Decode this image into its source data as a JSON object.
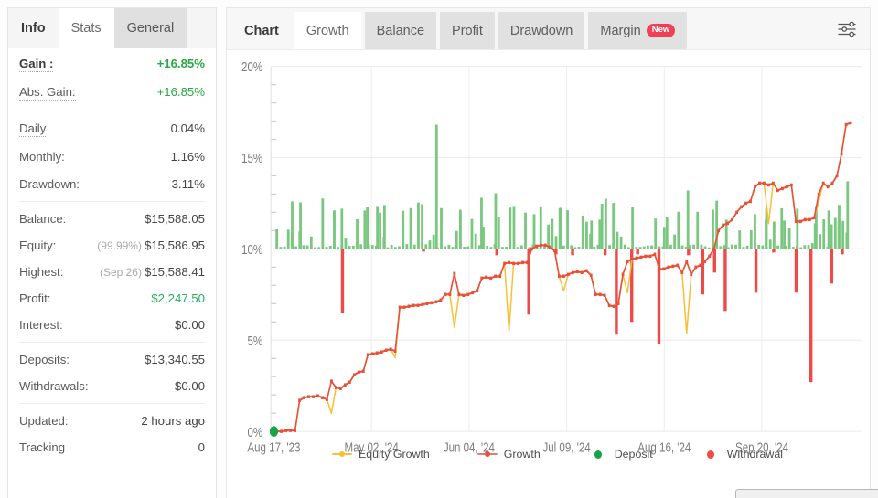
{
  "sidebar": {
    "tabs": [
      {
        "label": "Info",
        "state": "first"
      },
      {
        "label": "Stats",
        "state": "active"
      },
      {
        "label": "General",
        "state": "shaded"
      }
    ],
    "groups": [
      {
        "rows": [
          {
            "label": "Gain :",
            "value": "+16.85%",
            "style": "strong-green",
            "dotted": true
          },
          {
            "label": "Abs. Gain:",
            "value": "+16.85%",
            "style": "green",
            "dotted": true
          }
        ]
      },
      {
        "rows": [
          {
            "label": "Daily",
            "value": "0.04%",
            "style": "plain",
            "dotted": true
          },
          {
            "label": "Monthly:",
            "value": "1.16%",
            "style": "plain",
            "dotted": true
          },
          {
            "label": "Drawdown:",
            "value": "3.11%",
            "style": "plain",
            "dotted": false
          }
        ]
      },
      {
        "rows": [
          {
            "label": "Balance:",
            "value": "$15,588.05",
            "style": "plain",
            "dotted": false
          },
          {
            "label": "Equity:",
            "value": "$15,586.95",
            "sub": "(99.99%)",
            "style": "plain",
            "dotted": false
          },
          {
            "label": "Highest:",
            "value": "$15,588.41",
            "sub": "(Sep 26)",
            "style": "plain",
            "dotted": false
          },
          {
            "label": "Profit:",
            "value": "$2,247.50",
            "style": "green-b",
            "dotted": false
          },
          {
            "label": "Interest:",
            "value": "$0.00",
            "style": "plain",
            "dotted": false
          }
        ]
      },
      {
        "rows": [
          {
            "label": "Deposits:",
            "value": "$13,340.55",
            "style": "plain",
            "dotted": false
          },
          {
            "label": "Withdrawals:",
            "value": "$0.00",
            "style": "plain",
            "dotted": false
          }
        ]
      },
      {
        "rows": [
          {
            "label": "Updated:",
            "value": "2 hours ago",
            "style": "plain",
            "dotted": false
          },
          {
            "label": "Tracking",
            "value": "0",
            "style": "plain",
            "dotted": false
          }
        ]
      }
    ]
  },
  "chart_panel": {
    "tabs": [
      {
        "label": "Chart",
        "state": "first",
        "badge": ""
      },
      {
        "label": "Growth",
        "state": "active",
        "badge": ""
      },
      {
        "label": "Balance",
        "state": "normal",
        "badge": ""
      },
      {
        "label": "Profit",
        "state": "normal",
        "badge": ""
      },
      {
        "label": "Drawdown",
        "state": "normal",
        "badge": ""
      },
      {
        "label": "Margin",
        "state": "normal",
        "badge": "New"
      }
    ],
    "settings_icon": "sliders-icon"
  },
  "colors": {
    "growth": "#e8503a",
    "equity": "#f7c137",
    "deposit": "#16a34a",
    "deposit_bar": "#7ac77f",
    "withdrawal": "#ef4a4a",
    "grid": "#eeeeee",
    "axis_text": "#808080",
    "green_text": "#28a745",
    "badge_red": "#ef4056"
  },
  "chart_data": {
    "type": "line",
    "title": "Growth",
    "xlabel": "",
    "ylabel": "",
    "ylim": [
      0,
      20
    ],
    "yticks": [
      0,
      5,
      10,
      15,
      20
    ],
    "ytick_labels": [
      "0%",
      "5%",
      "10%",
      "15%",
      "20%"
    ],
    "grid": true,
    "legend_position": "bottom",
    "xtick_labels": [
      "Aug 17, '23",
      "May 02, '24",
      "Jun 04, '24",
      "Jul 09, '24",
      "Aug 16, '24",
      "Sep 20, '24"
    ],
    "xtick_positions": [
      0.5,
      17.0,
      33.5,
      50.0,
      66.5,
      83.0
    ],
    "bar_baseline": 10,
    "series": [
      {
        "name": "Growth",
        "type": "line",
        "color": "#e8503a",
        "x": [
          0,
          1,
          2,
          3,
          4,
          5,
          6,
          7,
          8,
          9,
          10,
          11,
          12,
          13,
          14,
          15,
          16,
          17,
          18,
          19,
          20,
          21,
          22,
          23,
          24,
          25,
          26,
          27,
          28,
          29,
          30,
          31,
          32,
          33,
          34,
          35,
          36,
          37,
          38,
          39,
          40,
          41,
          42,
          43,
          44,
          45,
          46,
          47,
          48,
          49,
          50,
          51,
          52,
          53,
          54,
          55,
          56,
          57,
          58,
          59,
          60,
          61,
          62,
          63,
          64,
          65,
          66,
          67,
          68,
          69,
          70,
          71,
          72,
          73,
          74,
          75,
          76,
          77,
          78,
          79,
          80,
          81,
          82,
          83,
          84,
          85,
          86,
          87,
          88,
          89,
          90,
          91,
          92,
          93,
          94,
          95,
          96,
          97,
          98,
          99,
          100
        ],
        "values": [
          0.0,
          0.0,
          0.05,
          0.05,
          0.05,
          1.7,
          1.85,
          1.9,
          1.9,
          1.95,
          1.85,
          1.75,
          2.75,
          2.4,
          2.35,
          2.55,
          2.7,
          3.1,
          3.25,
          3.3,
          4.2,
          4.25,
          4.3,
          4.35,
          4.45,
          4.5,
          4.4,
          6.8,
          6.8,
          6.85,
          6.9,
          6.9,
          6.95,
          7.0,
          7.05,
          7.1,
          7.2,
          7.5,
          7.5,
          8.65,
          7.5,
          7.45,
          7.5,
          7.6,
          7.7,
          8.4,
          8.45,
          8.4,
          8.5,
          8.5,
          9.2,
          9.25,
          9.2,
          9.2,
          9.25,
          9.25,
          10.0,
          10.15,
          10.2,
          10.2,
          10.1,
          9.9,
          8.5,
          8.5,
          8.6,
          8.7,
          8.75,
          8.7,
          8.8,
          8.55,
          7.5,
          7.5,
          7.45,
          6.9,
          6.85,
          7.0,
          8.6,
          9.3,
          9.45,
          9.5,
          9.55,
          9.6,
          9.6,
          9.7,
          8.9,
          8.9,
          9.0,
          9.05,
          9.1,
          8.7,
          9.3,
          8.6,
          9.0,
          9.1,
          9.3,
          9.6,
          10.0,
          11.0,
          11.3,
          11.4,
          11.6,
          12.0,
          12.3,
          12.5,
          12.6,
          13.4,
          13.6,
          13.6,
          13.5,
          13.6,
          13.2,
          13.3,
          13.4,
          13.5,
          11.5,
          11.5,
          11.6,
          11.6,
          11.7,
          13.0,
          13.6,
          13.4,
          13.6,
          14.0,
          15.2,
          16.8,
          16.9
        ],
        "note": "Red growth curve with small square markers rising from 0% to ~16.9%"
      },
      {
        "name": "Equity Growth",
        "type": "line",
        "color": "#f7c137",
        "note": "Yellow line closely tracking Growth, dipping sharply at withdrawal events (deep drops near 1.0%, 4.0%, 5.7%, 5.5%, 7.7%, 7.6% regions)"
      },
      {
        "name": "Deposit",
        "type": "bar",
        "color": "#7ac77f",
        "direction": "up",
        "baseline": 10,
        "note": "Green bars above 10% baseline; tallest ~16.8% near May 02 '24"
      },
      {
        "name": "Withdrawal",
        "type": "bar",
        "color": "#ef4a4a",
        "direction": "down",
        "baseline": 10,
        "note": "Red bars below 10% baseline; deepest ~2.7% near Sep 20 '24"
      }
    ],
    "markers": [
      {
        "name": "Deposit",
        "x": 0.5,
        "y": 0.0,
        "color": "#16a34a"
      }
    ],
    "legend": [
      {
        "label": "Equity Growth",
        "color": "#f7c137",
        "marker": "line"
      },
      {
        "label": "Growth",
        "color": "#e8503a",
        "marker": "line"
      },
      {
        "label": "Deposit",
        "color": "#16a34a",
        "marker": "dot"
      },
      {
        "label": "Withdrawal",
        "color": "#ef4a4a",
        "marker": "dot"
      }
    ]
  }
}
